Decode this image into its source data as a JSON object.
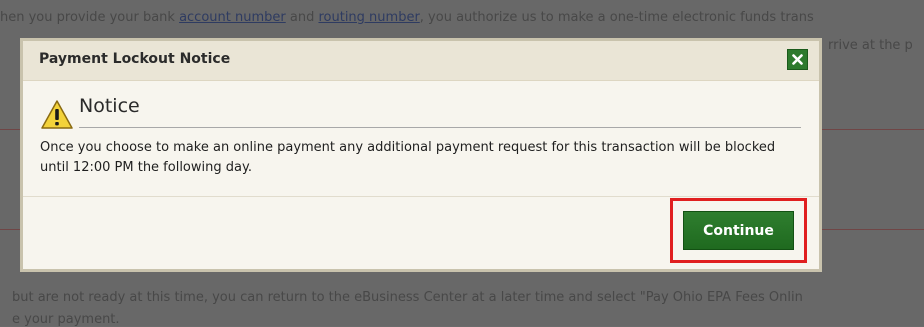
{
  "background": {
    "line1_pre": "hen you provide your bank ",
    "line1_link1": "account number",
    "line1_mid": " and ",
    "line1_link2": "routing number",
    "line1_post": ", you authorize us to make a one-time electronic funds trans",
    "line2_right": "rrive at the p",
    "line3": "but are not ready at this time, you can return to the eBusiness Center at a later time and select \"Pay Ohio EPA Fees Onlin",
    "line4": "e your payment."
  },
  "modal": {
    "title": "Payment Lockout Notice",
    "close_icon": "close-icon",
    "heading": "Notice",
    "warning_icon": "warning-icon",
    "message": "Once you choose to make an online payment any additional payment request for this transaction will be blocked until 12:00 PM the following day.",
    "continue_label": "Continue"
  },
  "colors": {
    "button_green": "#2a762a",
    "highlight_red": "#e01f1f",
    "modal_bg": "#f7f5ee"
  }
}
